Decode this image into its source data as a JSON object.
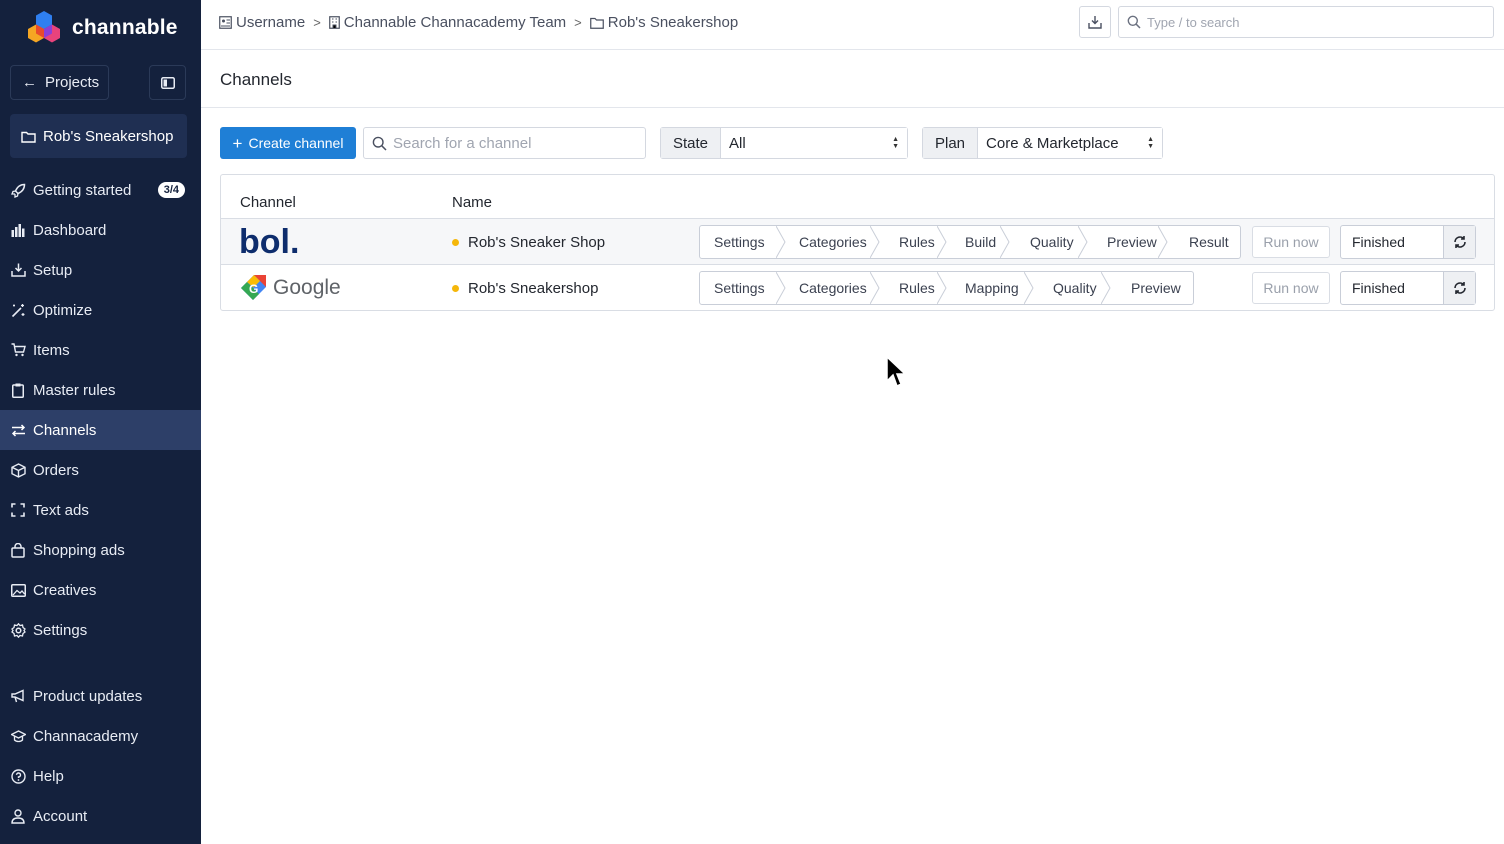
{
  "app": {
    "logo_text": "channable",
    "colors": {
      "sidebar": "#14213d",
      "accent": "#1f7fd6",
      "status_dot": "#f5b70a"
    }
  },
  "sidebar": {
    "projects_label": "Projects",
    "project_name": "Rob's Sneakershop",
    "items": [
      {
        "label": "Getting started",
        "icon": "rocket-icon",
        "badge": "3/4"
      },
      {
        "label": "Dashboard",
        "icon": "bar-chart-icon"
      },
      {
        "label": "Setup",
        "icon": "import-icon"
      },
      {
        "label": "Optimize",
        "icon": "magic-wand-icon"
      },
      {
        "label": "Items",
        "icon": "cart-icon"
      },
      {
        "label": "Master rules",
        "icon": "clipboard-icon"
      },
      {
        "label": "Channels",
        "icon": "arrows-icon",
        "active": true
      },
      {
        "label": "Orders",
        "icon": "box-icon"
      },
      {
        "label": "Text ads",
        "icon": "frame-icon"
      },
      {
        "label": "Shopping ads",
        "icon": "bag-icon"
      },
      {
        "label": "Creatives",
        "icon": "image-icon"
      },
      {
        "label": "Settings",
        "icon": "gear-icon"
      }
    ],
    "bottom_items": [
      {
        "label": "Product updates",
        "icon": "megaphone-icon"
      },
      {
        "label": "Channacademy",
        "icon": "graduation-cap-icon"
      },
      {
        "label": "Help",
        "icon": "help-icon"
      },
      {
        "label": "Account",
        "icon": "user-icon"
      }
    ]
  },
  "topbar": {
    "breadcrumb": [
      "Username",
      "Channable Channacademy Team",
      "Rob's Sneakershop"
    ],
    "search_placeholder": "Type / to search"
  },
  "page": {
    "title": "Channels",
    "create_label": "Create channel",
    "search_placeholder": "Search for a channel",
    "filters": {
      "state_label": "State",
      "state_value": "All",
      "plan_label": "Plan",
      "plan_value": "Core & Marketplace"
    }
  },
  "table": {
    "headers": {
      "channel": "Channel",
      "name": "Name"
    },
    "rows": [
      {
        "channel": "bol.",
        "name": "Rob's Sneaker Shop",
        "steps": [
          "Settings",
          "Categories",
          "Rules",
          "Build",
          "Quality",
          "Preview",
          "Result"
        ],
        "run_label": "Run now",
        "status": "Finished"
      },
      {
        "channel": "Google",
        "name": "Rob's Sneakershop",
        "steps": [
          "Settings",
          "Categories",
          "Rules",
          "Mapping",
          "Quality",
          "Preview"
        ],
        "run_label": "Run now",
        "status": "Finished"
      }
    ]
  }
}
